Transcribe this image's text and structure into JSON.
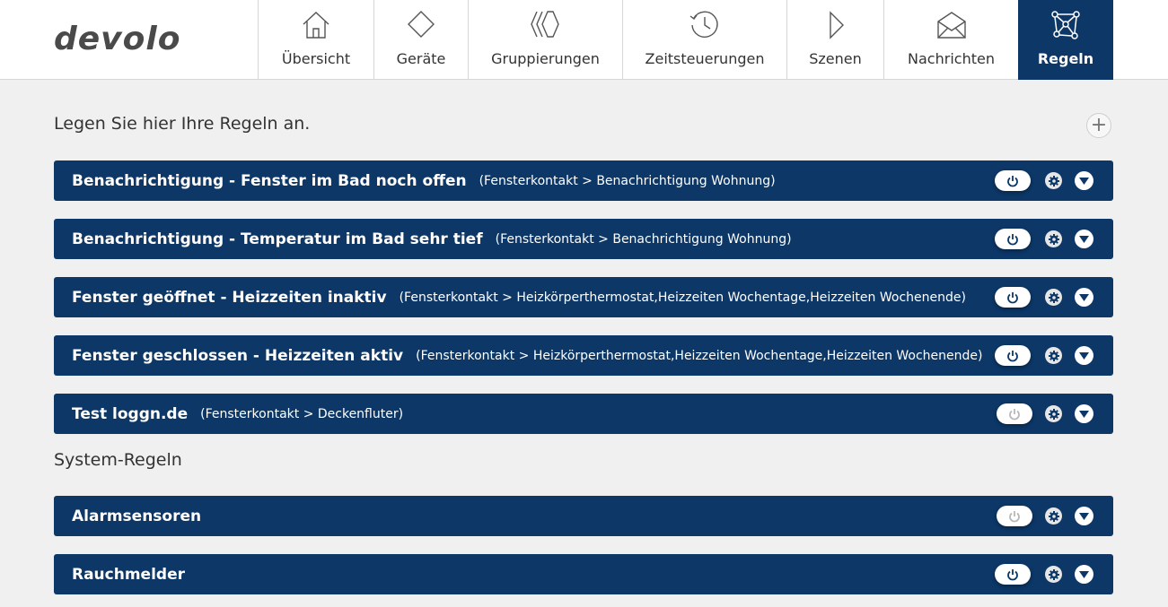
{
  "header": {
    "logo_text": "devolo",
    "nav": [
      {
        "label": "Übersicht",
        "icon": "home-icon"
      },
      {
        "label": "Geräte",
        "icon": "diamond-icon"
      },
      {
        "label": "Gruppierungen",
        "icon": "groups-icon"
      },
      {
        "label": "Zeitsteuerungen",
        "icon": "clock-icon"
      },
      {
        "label": "Szenen",
        "icon": "play-icon"
      },
      {
        "label": "Nachrichten",
        "icon": "envelope-icon"
      },
      {
        "label": "Regeln",
        "icon": "network-icon",
        "active": true
      }
    ]
  },
  "main": {
    "intro": "Legen Sie hier Ihre Regeln an.",
    "add_label": "+",
    "rules": [
      {
        "title": "Benachrichtigung - Fenster im Bad noch offen",
        "desc": "(Fensterkontakt > Benachrichtigung Wohnung)",
        "enabled": true
      },
      {
        "title": "Benachrichtigung - Temperatur im Bad sehr tief",
        "desc": "(Fensterkontakt > Benachrichtigung Wohnung)",
        "enabled": true
      },
      {
        "title": "Fenster geöffnet - Heizzeiten inaktiv",
        "desc": "(Fensterkontakt > Heizkörperthermostat,Heizzeiten Wochentage,Heizzeiten Wochenende)",
        "enabled": true
      },
      {
        "title": "Fenster geschlossen - Heizzeiten aktiv",
        "desc": "(Fensterkontakt > Heizkörperthermostat,Heizzeiten Wochentage,Heizzeiten Wochenende)",
        "enabled": true
      },
      {
        "title": "Test loggn.de",
        "desc": "(Fensterkontakt > Deckenfluter)",
        "enabled": false
      }
    ],
    "system_title": "System-Regeln",
    "system_rules": [
      {
        "title": "Alarmsensoren",
        "enabled": false
      },
      {
        "title": "Rauchmelder",
        "enabled": true
      }
    ]
  },
  "colors": {
    "brand_navy": "#0c3767",
    "background": "#f0f0f0",
    "power_on": "#0c3767",
    "power_off": "#b8b8b8"
  }
}
